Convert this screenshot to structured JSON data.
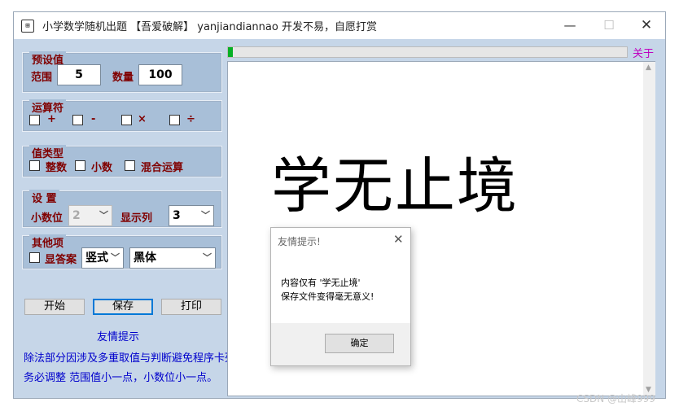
{
  "window": {
    "title": "小学数学随机出题 【吾爱破解】 yanjiandiannao 开发不易，自愿打赏",
    "icon": "calculator-icon",
    "min_glyph": "—",
    "max_glyph": "☐",
    "close_glyph": "✕"
  },
  "preset": {
    "title": "预设值",
    "range_label": "范围",
    "range_value": "5",
    "count_label": "数量",
    "count_value": "100"
  },
  "operators": {
    "title": "运算符",
    "items": [
      {
        "label": "+",
        "checked": false
      },
      {
        "label": "-",
        "checked": false
      },
      {
        "label": "×",
        "checked": false
      },
      {
        "label": "÷",
        "checked": false
      }
    ]
  },
  "value_type": {
    "title": "值类型",
    "items": [
      {
        "label": "整数",
        "checked": false
      },
      {
        "label": "小数",
        "checked": false
      },
      {
        "label": "混合运算",
        "checked": false
      }
    ]
  },
  "settings": {
    "title": "设 置",
    "decimal_label": "小数位",
    "decimal_value": "2",
    "columns_label": "显示列",
    "columns_value": "3"
  },
  "others": {
    "title": "其他项",
    "show_answer_label": "显答案",
    "show_answer_checked": false,
    "layout_value": "竖式",
    "font_value": "黑体"
  },
  "buttons": {
    "start": "开始",
    "save": "保存",
    "print": "打印"
  },
  "tips": {
    "title": "友情提示",
    "line1": "除法部分因涉及多重取值与判断避免程序卡死",
    "line2": "务必调整 范围值小一点，小数位小一点。"
  },
  "progress": {
    "fraction": 0.01,
    "color": "#06b025"
  },
  "about_label": "关于",
  "canvas": {
    "display_text": "学无止境"
  },
  "dialog": {
    "title": "友情提示!",
    "line1": "内容仅有 '学无止境'",
    "line2": "保存文件变得毫无意义!",
    "ok_label": "确定"
  },
  "watermark": "CSDN @山峰999"
}
